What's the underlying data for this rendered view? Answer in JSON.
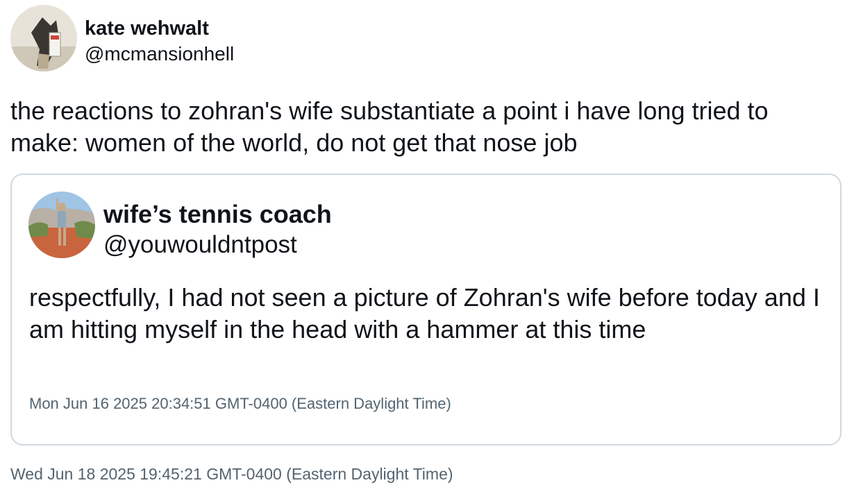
{
  "tweet": {
    "author": {
      "name": "kate wehwalt",
      "handle": "@mcmansionhell",
      "avatar_icon": "user-avatar"
    },
    "text": "the reactions to zohran's wife substantiate a point i have long tried to make: women of the world, do not get that nose job",
    "timestamp": "Wed Jun 18 2025 19:45:21 GMT-0400 (Eastern Daylight Time)",
    "quoted": {
      "author": {
        "name": "wife’s tennis coach",
        "handle": "@youwouldntpost",
        "avatar_icon": "user-avatar"
      },
      "text": "respectfully, I had not seen a picture of Zohran's wife before today and I am hitting myself in the head with a hammer at this time",
      "timestamp": "Mon Jun 16 2025 20:34:51 GMT-0400 (Eastern Daylight Time)"
    }
  },
  "colors": {
    "text": "#0f1419",
    "secondary_text": "#536471",
    "border": "#cfd9de",
    "background": "#ffffff"
  }
}
